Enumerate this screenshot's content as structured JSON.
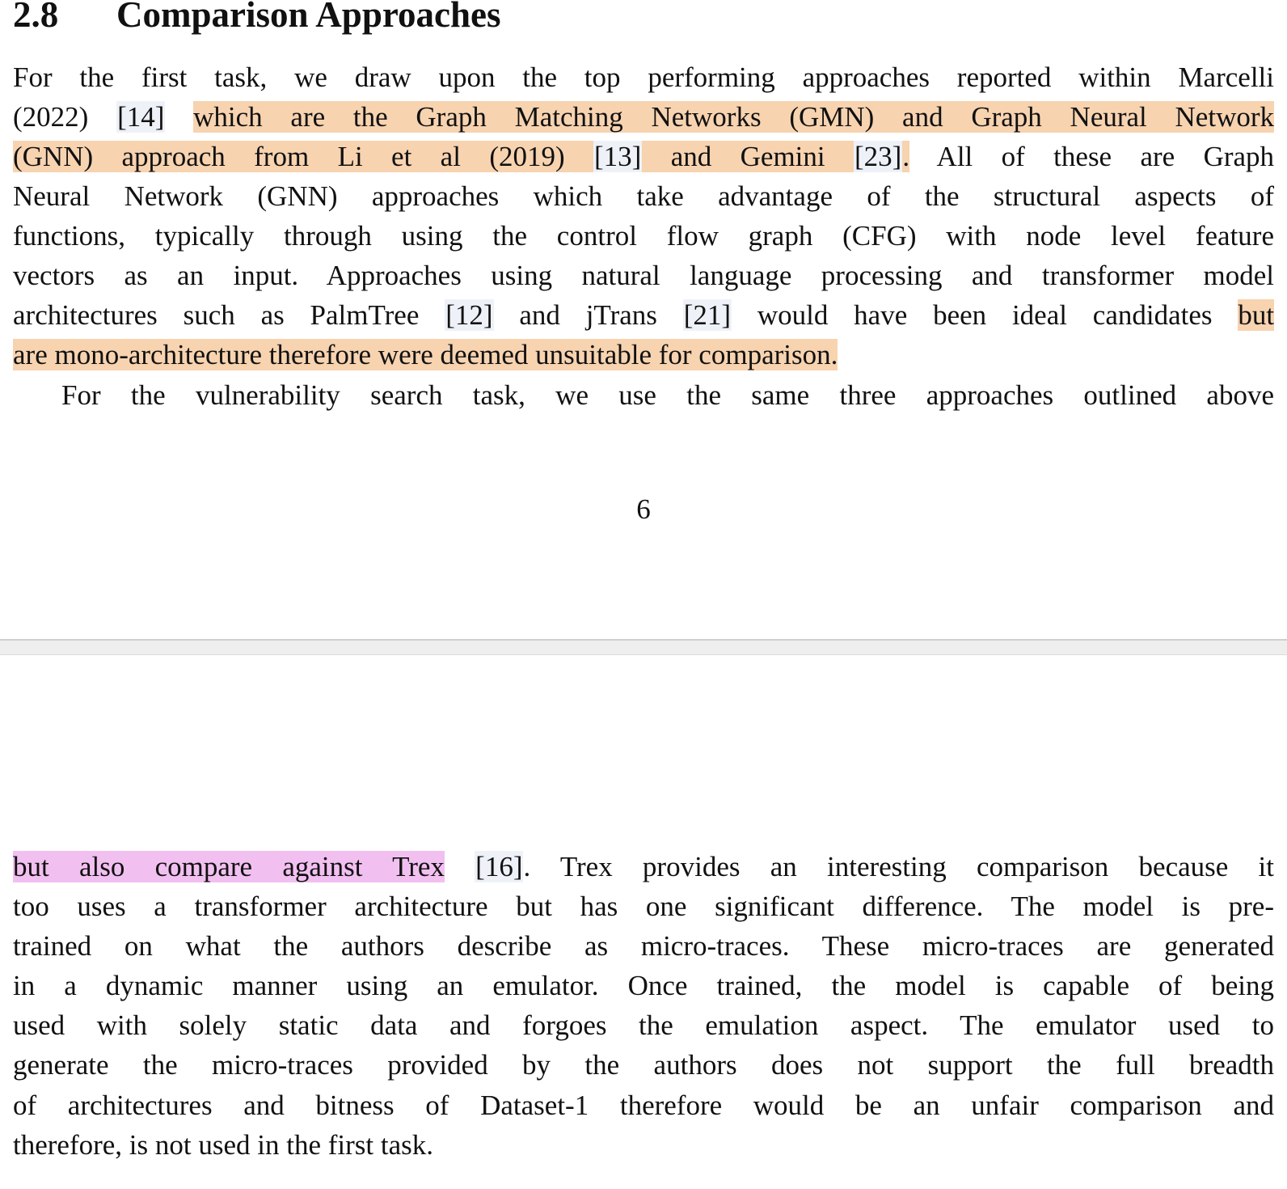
{
  "section": {
    "number": "2.8",
    "title": "Comparison Approaches"
  },
  "page1_lines": {
    "l1": "For the first task, we draw upon the top performing approaches reported within Marcelli",
    "l2a": "(2022)",
    "l2cite": "[14]",
    "l2hl": "which are the Graph Matching Networks (GMN) and Graph Neural Network",
    "l3hl1": "(GNN) approach from Li et al (2019)",
    "l3cite1": "[13]",
    "l3hl2": "and Gemini",
    "l3cite2": "[23]",
    "l3hl3": ".",
    "l3b": "All of these are Graph",
    "l4": "Neural Network (GNN) approaches which take advantage of the structural aspects of",
    "l5": "functions, typically through using the control flow graph (CFG) with node level feature",
    "l6": "vectors as an input. Approaches using natural language processing and transformer model",
    "l7a": "architectures such as PalmTree",
    "l7cite1": "[12]",
    "l7b": "and jTrans",
    "l7cite2": "[21]",
    "l7c": "would have been ideal candidates",
    "l7hl": "but",
    "l8hl": "are mono-architecture therefore were deemed unsuitable for comparison.",
    "l9": "For the vulnerability search task, we use the same three approaches outlined above"
  },
  "page_number": "6",
  "page2_lines": {
    "l1hl": "but also compare against Trex",
    "l1cite": "[16]",
    "l1b": ". Trex provides an interesting comparison because it",
    "l2": "too uses a transformer architecture but has one significant difference. The model is pre-",
    "l3": "trained on what the authors describe as micro-traces. These micro-traces are generated",
    "l4": "in a dynamic manner using an emulator. Once trained, the model is capable of being",
    "l5": "used with solely static data and forgoes the emulation aspect. The emulator used to",
    "l6": "generate the micro-traces provided by the authors does not support the full breadth",
    "l7": "of architectures and bitness of Dataset-1 therefore would be an unfair comparison and",
    "l8": "therefore, is not used in the first task."
  },
  "highlight_colors": {
    "orange": "#f7d3b0",
    "pink": "#f2c0f0",
    "citation": "#eef2f8"
  }
}
